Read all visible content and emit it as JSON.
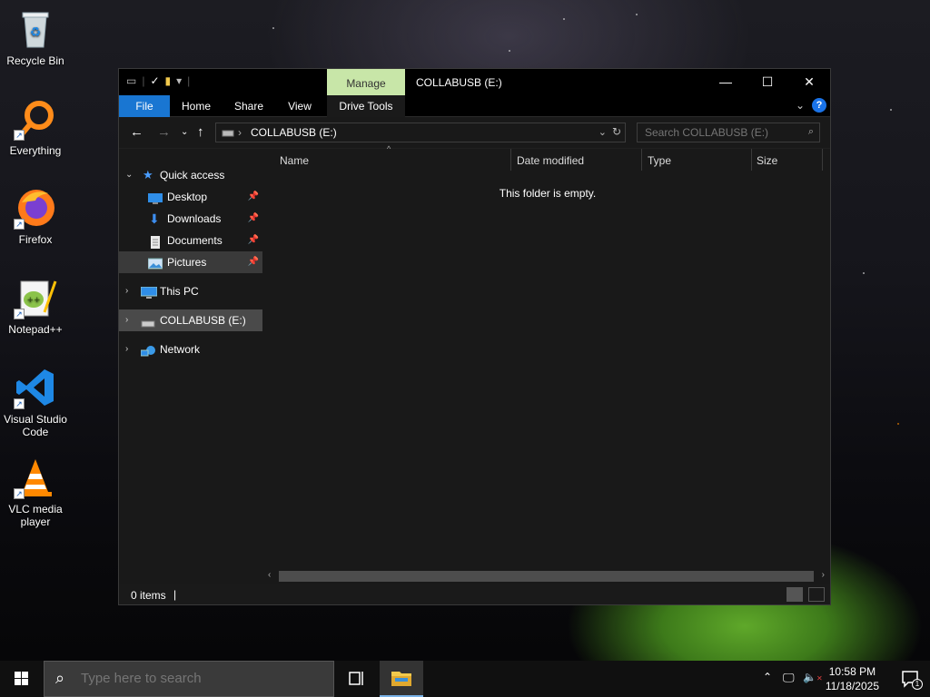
{
  "desktop": {
    "icons": [
      {
        "label": "Recycle Bin",
        "icon": "recycle-bin-icon"
      },
      {
        "label": "Everything",
        "icon": "everything-search-icon"
      },
      {
        "label": "Firefox",
        "icon": "firefox-icon"
      },
      {
        "label": "Notepad++",
        "icon": "notepad-plus-plus-icon"
      },
      {
        "label": "Visual Studio Code",
        "icon": "vscode-icon"
      },
      {
        "label": "VLC media player",
        "icon": "vlc-icon"
      }
    ]
  },
  "window": {
    "title": "COLLABUSB (E:)",
    "manage_tab": "Manage",
    "ribbon_tabs": [
      "File",
      "Home",
      "Share",
      "View",
      "Drive Tools"
    ],
    "address_path": "COLLABUSB (E:)",
    "search_placeholder": "Search COLLABUSB (E:)",
    "nav": {
      "quick_access": "Quick access",
      "pinned": [
        "Desktop",
        "Downloads",
        "Documents",
        "Pictures"
      ],
      "this_pc": "This PC",
      "drive": "COLLABUSB (E:)",
      "network": "Network"
    },
    "columns": [
      "Name",
      "Date modified",
      "Type",
      "Size"
    ],
    "empty_message": "This folder is empty.",
    "status": "0 items"
  },
  "taskbar": {
    "search_placeholder": "Type here to search",
    "time": "10:58 PM",
    "date": "11/18/2025",
    "notification_count": "1"
  },
  "colors": {
    "file_tab": "#1976d2",
    "manage_tab": "#c8e6a8",
    "window_bg": "#191919"
  }
}
